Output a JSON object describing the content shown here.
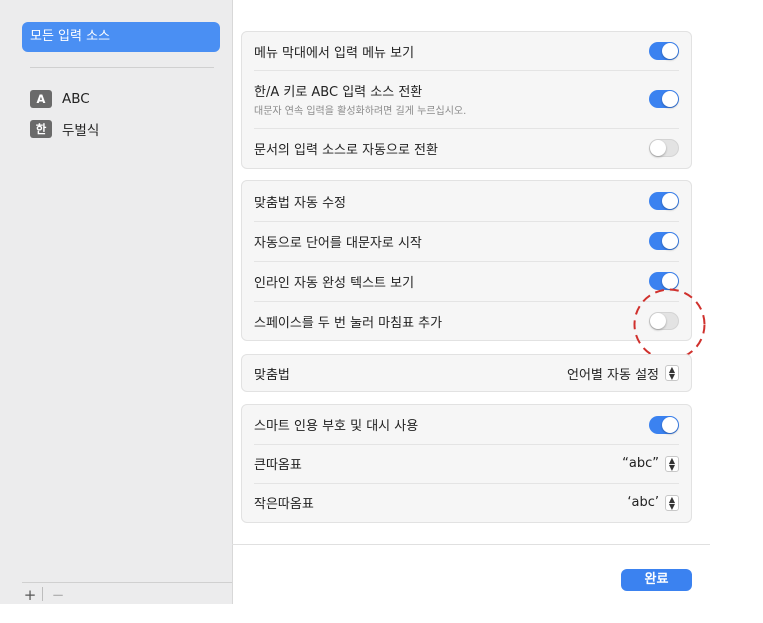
{
  "sidebar": {
    "selected_label": "모든 입력 소스",
    "sources": [
      {
        "glyph": "A",
        "label": "ABC"
      },
      {
        "glyph": "한",
        "label": "두벌식"
      }
    ],
    "add_label": "+",
    "remove_label": "−"
  },
  "group1": {
    "rows": [
      {
        "label": "메뉴 막대에서 입력 메뉴 보기",
        "toggle": "on"
      },
      {
        "label": "한/A 키로 ABC 입력 소스 전환",
        "sublabel": "대문자 연속 입력을 활성화하려면 길게 누르십시오.",
        "toggle": "on"
      },
      {
        "label": "문서의 입력 소스로 자동으로 전환",
        "toggle": "off"
      }
    ]
  },
  "group2": {
    "rows": [
      {
        "label": "맞춤법 자동 수정",
        "toggle": "on"
      },
      {
        "label": "자동으로 단어를 대문자로 시작",
        "toggle": "on"
      },
      {
        "label": "인라인 자동 완성 텍스트 보기",
        "toggle": "on"
      },
      {
        "label": "스페이스를 두 번 눌러 마침표 추가",
        "toggle": "off"
      }
    ]
  },
  "spelling": {
    "label": "맞춤법",
    "value": "언어별 자동 설정"
  },
  "group4": {
    "smart_quotes_label": "스마트 인용 부호 및 대시 사용",
    "smart_quotes_toggle": "on",
    "double_quotes_label": "큰따옴표",
    "double_quotes_value": "“abc”",
    "single_quotes_label": "작은따옴표",
    "single_quotes_value": "‘abc’"
  },
  "done_label": "완료",
  "colors": {
    "accent": "#3b82f0",
    "sidebar_selected": "#4a8ff3",
    "annotation": "#d0312d"
  },
  "icons": [
    "plus-icon",
    "minus-icon",
    "chevron-up-down-icon"
  ]
}
